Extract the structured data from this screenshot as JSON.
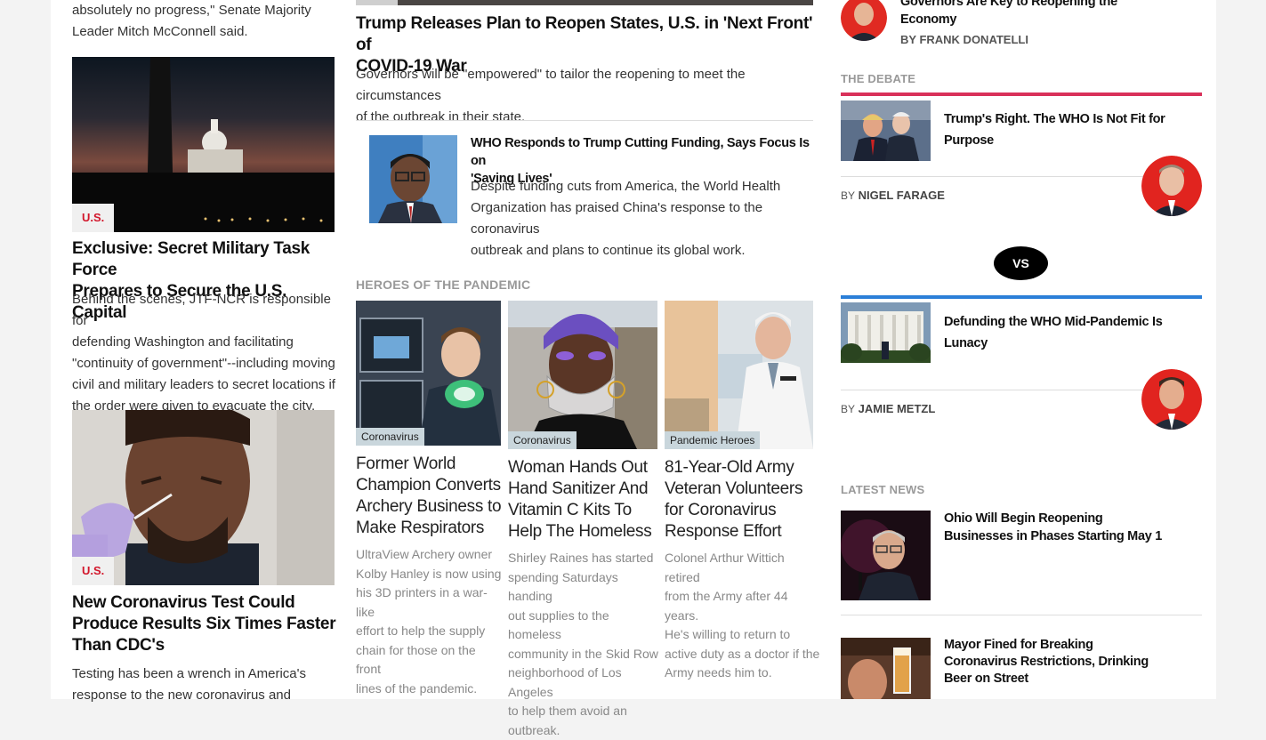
{
  "left": {
    "top_quote": [
      "absolutely no progress,\" Senate Majority",
      "Leader Mitch McConnell said."
    ],
    "story1": {
      "tag": "U.S.",
      "title": [
        "Exclusive: Secret Military Task Force",
        "Prepares to Secure the U.S. Capital"
      ],
      "body": [
        "Behind the scenes, JTF-NCR is responsible for",
        "defending Washington and facilitating",
        "\"continuity of government\"--including moving",
        "civil and military leaders to secret locations if",
        "the order were given to evacuate the city."
      ]
    },
    "story2": {
      "tag": "U.S.",
      "title": [
        "New Coronavirus Test Could",
        "Produce Results Six Times Faster",
        "Than CDC's"
      ],
      "body": [
        "Testing has been a wrench in America's",
        "response to the new coronavirus and"
      ]
    }
  },
  "middle": {
    "lead": {
      "title": [
        "Trump Releases Plan to Reopen States, U.S. in 'Next Front' of",
        "COVID-19 War"
      ],
      "body": [
        "Governors will be \"empowered\" to tailor the reopening to meet the circumstances",
        "of the outbreak in their state."
      ]
    },
    "who": {
      "title": [
        "WHO Responds to Trump Cutting Funding, Says Focus Is on",
        "'Saving Lives'"
      ],
      "body": [
        "Despite funding cuts from America, the World Health",
        "Organization has praised China's response to the coronavirus",
        "outbreak and plans to continue its global work."
      ]
    },
    "heroes_label": "HEROES OF THE PANDEMIC",
    "heroes": [
      {
        "tag": "Coronavirus",
        "title": [
          "Former World",
          "Champion Converts",
          "Archery Business to",
          "Make Respirators"
        ],
        "body": [
          "UltraView Archery owner",
          "Kolby Hanley is now using",
          "his 3D printers in a war-like",
          "effort to help the supply",
          "chain for those on the front",
          "lines of the pandemic."
        ]
      },
      {
        "tag": "Coronavirus",
        "title": [
          "Woman Hands Out",
          "Hand Sanitizer And",
          "Vitamin C Kits To",
          "Help The Homeless"
        ],
        "body": [
          "Shirley Raines has started",
          "spending Saturdays handing",
          "out supplies to the homeless",
          "community in the Skid Row",
          "neighborhood of Los Angeles",
          "to help them avoid an",
          "outbreak."
        ]
      },
      {
        "tag": "Pandemic Heroes",
        "title": [
          "81-Year-Old Army",
          "Veteran Volunteers",
          "for Coronavirus",
          "Response Effort"
        ],
        "body": [
          "Colonel Arthur Wittich retired",
          "from the Army after 44 years.",
          "He's willing to return to",
          "active duty as a doctor if the",
          "Army needs him to."
        ]
      }
    ]
  },
  "right": {
    "top_item": {
      "title": [
        "Governors Are Key to Reopening the",
        "Economy"
      ],
      "by": "BY",
      "author": "FRANK DONATELLI"
    },
    "debate_label": "THE DEBATE",
    "debate1": {
      "title": [
        "Trump's Right. The WHO Is Not Fit for",
        "Purpose"
      ],
      "by": "BY",
      "author": "NIGEL FARAGE"
    },
    "vs": "VS",
    "debate2": {
      "title": [
        "Defunding the WHO Mid-Pandemic Is",
        "Lunacy"
      ],
      "by": "BY",
      "author": "JAMIE METZL"
    },
    "latest_label": "LATEST NEWS",
    "latest": [
      {
        "title": [
          "Ohio Will Begin Reopening",
          "Businesses in Phases Starting May 1"
        ]
      },
      {
        "title": [
          "Mayor Fined for Breaking",
          "Coronavirus Restrictions, Drinking",
          "Beer on Street"
        ]
      }
    ]
  },
  "colors": {
    "tag_red": "#d2162b",
    "debate_red": "#d9315a",
    "debate_blue": "#2b7fd8"
  }
}
